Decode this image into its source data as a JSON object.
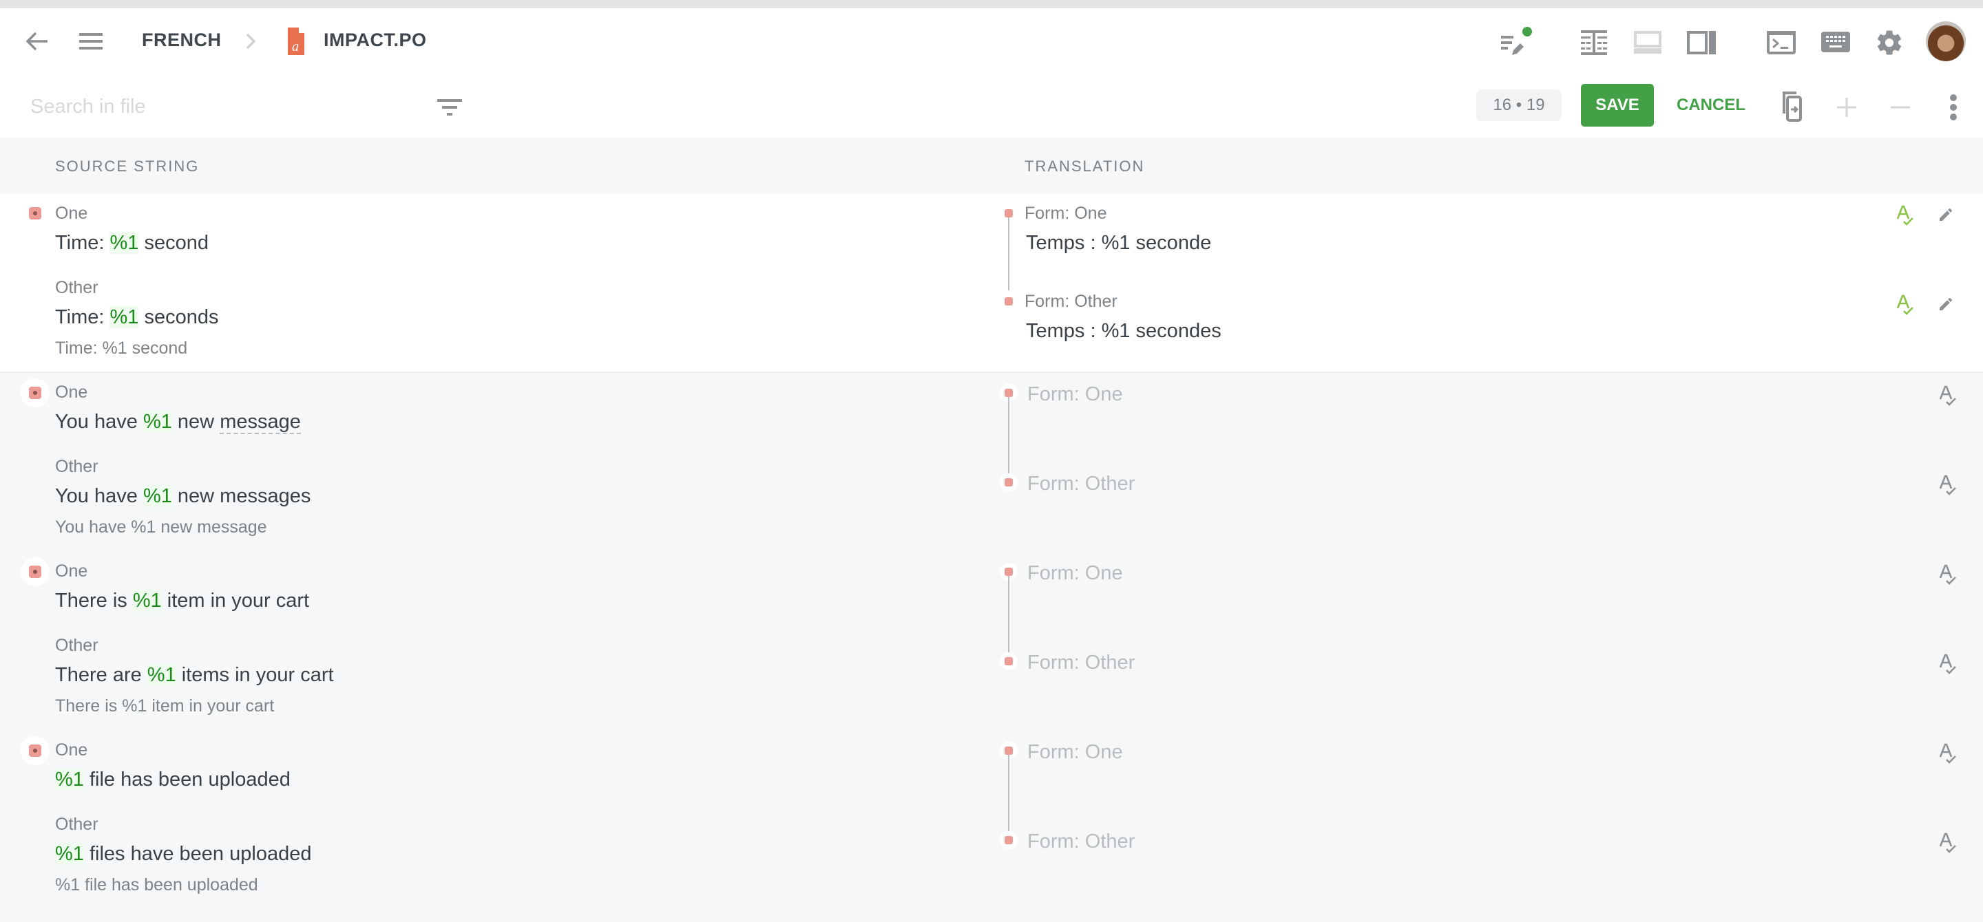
{
  "header": {
    "back_icon": "arrow-left-icon",
    "menu_icon": "hamburger-menu-icon",
    "breadcrumb": {
      "language": "FRENCH",
      "separator_icon": "chevron-right-icon",
      "file_icon": "po-file-icon",
      "file_icon_glyph": "a",
      "file_name": "IMPACT.PO"
    },
    "right_icons": [
      {
        "name": "edit-list-icon",
        "has_status_dot": true,
        "status_color": "#43a047"
      },
      {
        "name": "columns-layout-icon"
      },
      {
        "name": "horizontal-split-icon"
      },
      {
        "name": "sidebar-panel-icon"
      },
      {
        "name": "terminal-icon"
      },
      {
        "name": "keyboard-icon"
      },
      {
        "name": "settings-gear-icon"
      }
    ],
    "avatar": "user-avatar"
  },
  "toolbar": {
    "search_placeholder": "Search in file",
    "search_value": "",
    "filter_icon": "filter-icon",
    "counter": "16 • 19",
    "save_label": "SAVE",
    "cancel_label": "CANCEL",
    "copy_source_icon": "copy-source-icon",
    "add_icon": "plus-icon",
    "remove_icon": "minus-icon",
    "more_icon": "more-vertical-icon"
  },
  "columns": {
    "source": "SOURCE STRING",
    "translation": "TRANSLATION"
  },
  "colors": {
    "accent": "#43a047",
    "placeholder_highlight": "#1b8a1b",
    "status_marker": "#ec9c95"
  },
  "rows": [
    {
      "active": true,
      "source": {
        "one_label": "One",
        "one_parts": [
          "Time: ",
          "%1",
          " second"
        ],
        "other_label": "Other",
        "other_parts": [
          "Time: ",
          "%1",
          " seconds"
        ],
        "context": "Time: %1 second"
      },
      "translation": {
        "one_label": "Form: One",
        "one_value": "Temps : %1 seconde",
        "other_label": "Form: Other",
        "other_value": "Temps : %1 secondes"
      }
    },
    {
      "active": false,
      "source": {
        "one_label": "One",
        "one_parts": [
          "You have ",
          "%1",
          " new ",
          "message"
        ],
        "other_label": "Other",
        "other_parts": [
          "You have ",
          "%1",
          " new messages"
        ],
        "context": "You have %1 new message"
      },
      "translation": {
        "one_placeholder": "Form: One",
        "other_placeholder": "Form: Other"
      }
    },
    {
      "active": false,
      "source": {
        "one_label": "One",
        "one_parts": [
          "There is ",
          "%1",
          " item in your cart"
        ],
        "other_label": "Other",
        "other_parts": [
          "There are ",
          "%1",
          " items in your cart"
        ],
        "context": "There is %1 item in your cart"
      },
      "translation": {
        "one_placeholder": "Form: One",
        "other_placeholder": "Form: Other"
      }
    },
    {
      "active": false,
      "source": {
        "one_label": "One",
        "one_parts": [
          "",
          "%1",
          " file has been uploaded"
        ],
        "other_label": "Other",
        "other_parts": [
          "",
          "%1",
          " files have been uploaded"
        ],
        "context": "%1 file has been uploaded"
      },
      "translation": {
        "one_placeholder": "Form: One",
        "other_placeholder": "Form: Other"
      }
    }
  ]
}
